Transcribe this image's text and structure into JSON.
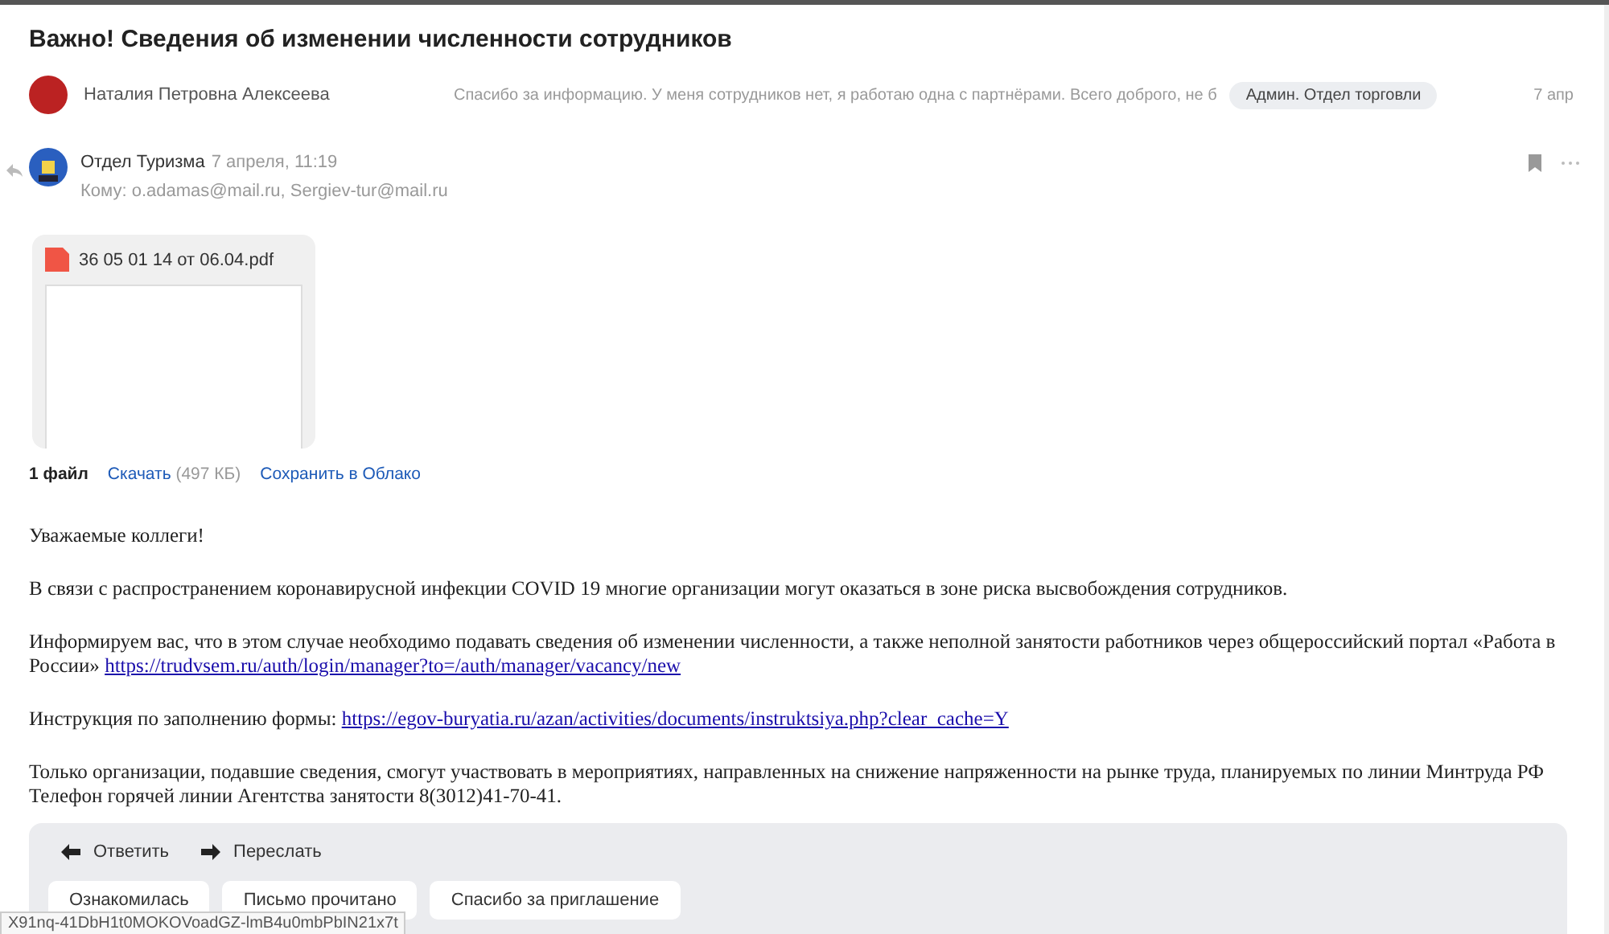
{
  "subject": "Важно! Сведения об изменении численности сотрудников",
  "thread_item": {
    "sender": "Наталия Петровна Алексеева",
    "snippet": "Спасибо за информацию. У меня сотрудников нет, я работаю одна с партнёрами. Всего доброго, не б",
    "tag": "Админ. Отдел торговли",
    "date": "7 апр"
  },
  "message": {
    "sender": "Отдел Туризма",
    "date": "7 апреля, 11:19",
    "to": "Кому: o.adamas@mail.ru, Sergiev-tur@mail.ru"
  },
  "attachment": {
    "filename": "36 05 01 14 от 06.04.pdf",
    "count": "1 файл",
    "download": "Скачать",
    "size": "(497 КБ)",
    "save": "Сохранить в Облако"
  },
  "body": [
    {
      "lines": [
        {
          "text": "Уважаемые коллеги!"
        }
      ]
    },
    {
      "lines": [
        {
          "text": "В связи с распространением коронавирусной инфекции COVID 19 многие организации могут оказаться в зоне риска высвобождения сотрудников."
        }
      ]
    },
    {
      "lines": [
        {
          "text": "Информируем вас, что в этом случае необходимо подавать сведения об изменении численности, а также неполной занятости работников через общероссийский портал «Работа в России»",
          "link": "https://trudvsem.ru/auth/login/manager?to=/auth/manager/vacancy/new"
        }
      ]
    },
    {
      "lines": [
        {
          "text": "Инструкция по заполнению формы:",
          "link": "https://egov-buryatia.ru/azan/activities/documents/instruktsiya.php?clear_cache=Y"
        }
      ]
    },
    {
      "lines": [
        {
          "text": "Только организации, подавшие сведения, смогут участвовать в мероприятиях, направленных на снижение напряженности на рынке труда, планируемых по линии Минтруда РФ"
        },
        {
          "text": "Телефон горячей линии Агентства занятости 8(3012)41-70-41."
        }
      ]
    }
  ],
  "actions": [
    "Ответить",
    "Переслать"
  ],
  "quick_replies": [
    "Ознакомилась",
    "Письмо прочитано",
    "Спасибо за приглашение"
  ],
  "status_url": "X91nq-41DbH1t0MOKOVoadGZ-lmB4u0mbPbIN21x7t"
}
